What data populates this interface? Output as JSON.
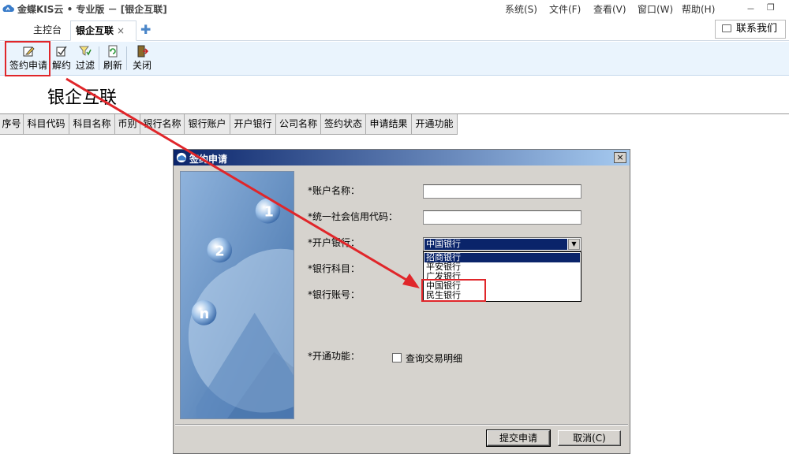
{
  "window": {
    "title": "金蝶KIS云 • 专业版 － [银企互联]",
    "menu": [
      "系统(S)",
      "文件(F)",
      "查看(V)",
      "窗口(W)",
      "帮助(H)"
    ],
    "minimize": "－",
    "restore": "❐"
  },
  "tabs": {
    "home": "主控台",
    "active": "银企互联",
    "close": "×",
    "add": "✚"
  },
  "contact": {
    "label": "联系我们"
  },
  "toolbar": {
    "sign": "签约申请",
    "cancel": "解约",
    "filter": "过滤",
    "refresh": "刷新",
    "close": "关闭"
  },
  "page": {
    "title": "银企互联"
  },
  "grid": {
    "columns": [
      "序号",
      "科目代码",
      "科目名称",
      "币别",
      "银行名称",
      "银行账户",
      "开户银行",
      "公司名称",
      "签约状态",
      "申请结果",
      "开通功能"
    ]
  },
  "dialog": {
    "title": "签约申请",
    "close": "×",
    "fields": {
      "account_name": "*账户名称：",
      "credit_code": "*统一社会信用代码：",
      "bank": "*开户银行：",
      "subject": "*银行科目：",
      "account_no": "*银行账号：",
      "function": "*开通功能："
    },
    "bank_selected": "中国银行",
    "bank_options": [
      "招商银行",
      "平安银行",
      "广发银行",
      "中国银行",
      "民生银行"
    ],
    "query_detail": "查询交易明细",
    "submit": "提交申请",
    "cancel": "取消(C)"
  },
  "colors": {
    "highlight": "#e0262a",
    "selection": "#0a246a",
    "toolbar_bg": "#eaf4fd"
  },
  "icons": [
    "app-logo-icon",
    "edit-icon",
    "unsign-icon",
    "filter-icon",
    "refresh-icon",
    "exit-icon",
    "plus-icon",
    "chat-icon"
  ]
}
